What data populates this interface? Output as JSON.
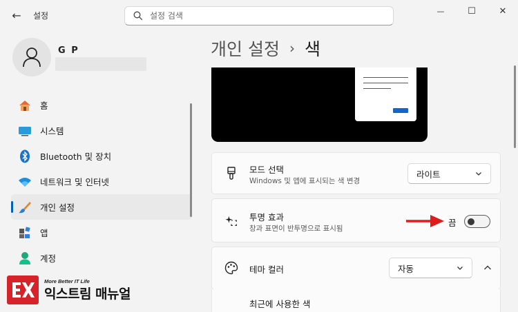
{
  "window": {
    "title": "설정",
    "back_glyph": "←",
    "minimize_glyph": "—",
    "maximize_glyph": "☐",
    "close_glyph": "✕"
  },
  "search": {
    "placeholder": "설정 검색",
    "value": ""
  },
  "profile": {
    "name": "G P"
  },
  "sidebar": {
    "items": [
      {
        "label": "홈",
        "icon": "home-icon",
        "active": false
      },
      {
        "label": "시스템",
        "icon": "system-icon",
        "active": false
      },
      {
        "label": "Bluetooth 및 장치",
        "icon": "bluetooth-icon",
        "active": false
      },
      {
        "label": "네트워크 및 인터넷",
        "icon": "wifi-icon",
        "active": false
      },
      {
        "label": "개인 설정",
        "icon": "brush-icon",
        "active": true
      },
      {
        "label": "앱",
        "icon": "apps-icon",
        "active": false
      },
      {
        "label": "계정",
        "icon": "account-icon",
        "active": false
      }
    ]
  },
  "breadcrumb": {
    "parent": "개인 설정",
    "separator": "›",
    "current": "색"
  },
  "mode_card": {
    "title": "모드 선택",
    "description": "Windows 및 앱에 표시되는 색 변경",
    "selected": "라이트"
  },
  "transparency_card": {
    "title": "투명 효과",
    "description": "창과 표면이 반투명으로 표시됨",
    "state_label": "끔",
    "on": false
  },
  "theme_color_card": {
    "title": "테마 컬러",
    "selected": "자동",
    "recent_colors_label": "최근에 사용한 색"
  },
  "watermark": {
    "subtitle": "More Better IT Life",
    "title": "익스트림 매뉴얼",
    "logo_text": "EX"
  },
  "colors": {
    "accent": "#005fb8",
    "arrow": "#e01b1b",
    "watermark_red": "#d6232a"
  }
}
